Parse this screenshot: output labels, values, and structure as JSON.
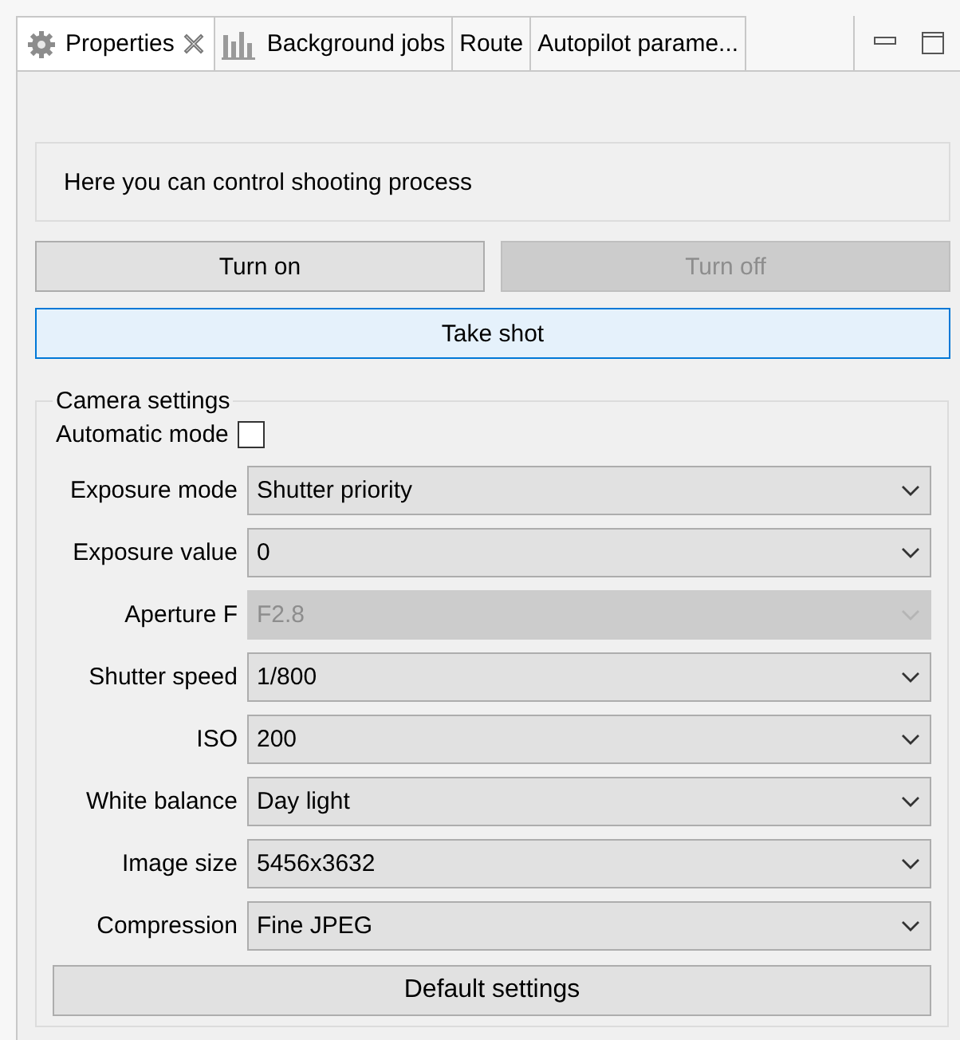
{
  "tabs": [
    {
      "label": "Properties",
      "selected": true
    },
    {
      "label": "Background jobs",
      "selected": false
    },
    {
      "label": "Route",
      "selected": false
    },
    {
      "label": "Autopilot parame...",
      "selected": false
    }
  ],
  "info": {
    "text": "Here you can control shooting process"
  },
  "buttons": [
    {
      "label": "Turn on",
      "disabled": false
    },
    {
      "label": "Turn off",
      "disabled": true
    }
  ],
  "take_shot": {
    "label": "Take shot",
    "focused": true
  },
  "camera_settings": {
    "title": "Camera settings",
    "automatic_mode": {
      "label": "Automatic mode",
      "checked": false
    },
    "fields": [
      {
        "label": "Exposure mode",
        "value": "Shutter priority",
        "disabled": false
      },
      {
        "label": "Exposure value",
        "value": "0",
        "disabled": false
      },
      {
        "label": "Aperture F",
        "value": "F2.8",
        "disabled": true
      },
      {
        "label": "Shutter speed",
        "value": "1/800",
        "disabled": false
      },
      {
        "label": "ISO",
        "value": "200",
        "disabled": false
      },
      {
        "label": "White balance",
        "value": "Day light",
        "disabled": false
      },
      {
        "label": "Image size",
        "value": "5456x3632",
        "disabled": false
      },
      {
        "label": "Compression",
        "value": "Fine JPEG",
        "disabled": false
      }
    ],
    "default_button": {
      "label": "Default settings"
    }
  }
}
